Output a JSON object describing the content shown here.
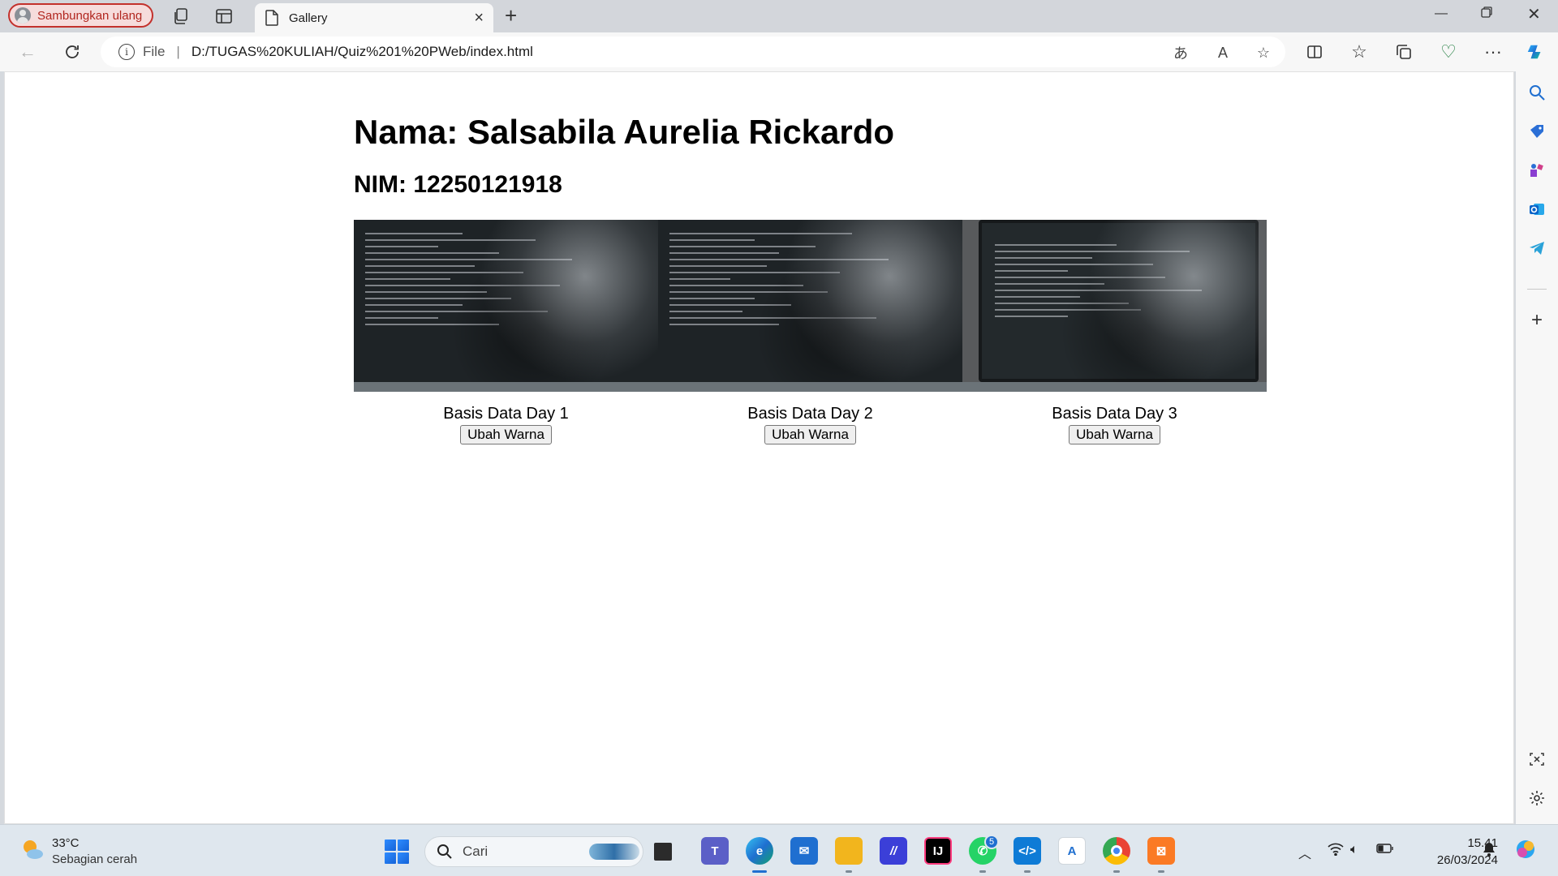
{
  "browser": {
    "profile_label": "Sambungkan ulang",
    "tab_title": "Gallery",
    "file_label": "File",
    "address": "D:/TUGAS%20KULIAH/Quiz%201%20PWeb/index.html",
    "toolbar_icons": [
      "read-aloud-icon",
      "text-size-icon",
      "favorite-star-icon",
      "split-screen-icon",
      "favorites-icon",
      "collections-icon",
      "browser-essentials-icon",
      "more-icon",
      "copilot-icon"
    ],
    "sidebar_icons": [
      "search-icon",
      "shopping-icon",
      "tools-icon",
      "outlook-icon",
      "telegram-icon",
      "add-icon",
      "screenshot-icon",
      "settings-icon"
    ]
  },
  "page": {
    "name_heading": "Nama: Salsabila Aurelia Rickardo",
    "nim_heading": "NIM: 12250121918",
    "gallery": [
      {
        "caption": "Basis Data Day 1",
        "button": "Ubah Warna"
      },
      {
        "caption": "Basis Data Day 2",
        "button": "Ubah Warna"
      },
      {
        "caption": "Basis Data Day 3",
        "button": "Ubah Warna"
      }
    ]
  },
  "taskbar": {
    "weather_temp": "33°C",
    "weather_desc": "Sebagian cerah",
    "search_placeholder": "Cari",
    "whatsapp_badge": "5",
    "time": "15.41",
    "date": "26/03/2024",
    "apps": [
      "start-icon",
      "search",
      "task-view-icon",
      "teams-icon",
      "edge-icon",
      "mail-icon",
      "file-explorer-icon",
      "vs-icon",
      "intellij-icon",
      "whatsapp-icon",
      "vscode-icon",
      "translate-icon",
      "chrome-icon",
      "xampp-icon"
    ]
  },
  "colors": {
    "accent": "#1f6fd0",
    "profile_border": "#c3312c"
  }
}
